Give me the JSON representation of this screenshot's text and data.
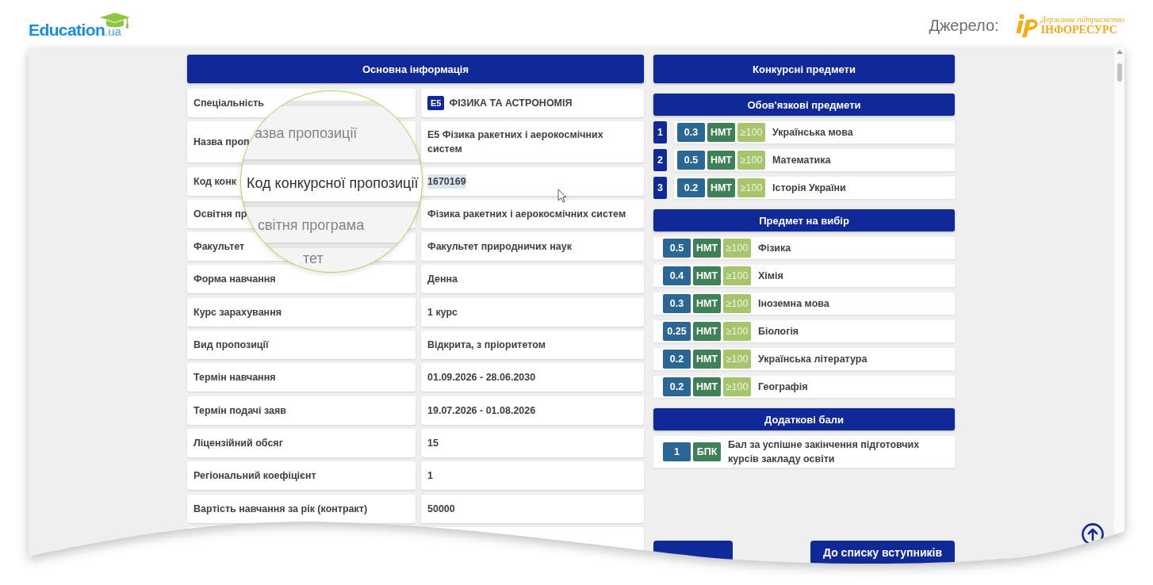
{
  "header": {
    "logo": {
      "name": "Education",
      "suffix": ".ua"
    },
    "source_label": "Джерело:",
    "source_logo": {
      "subtitle": "Державне підприємство",
      "name": "ІНФОРЕСУРС"
    }
  },
  "main_info": {
    "title": "Основна інформація",
    "rows": [
      {
        "label": "Спеціальність",
        "code": "E5",
        "value": "ФІЗИКА ТА АСТРОНОМІЯ",
        "text_selected": false
      },
      {
        "label": "Назва проп",
        "value": "E5 Фізика ракетних і аерокосмічних систем",
        "text_selected": false
      },
      {
        "label": "Код конк",
        "value": "1670169",
        "text_selected": true
      },
      {
        "label": "Освітня пр",
        "value": "Фізика ракетних і аерокосмічних систем",
        "text_selected": false
      },
      {
        "label": "Факультет",
        "value": "Факультет природничих наук",
        "text_selected": false
      },
      {
        "label": "Форма навчання",
        "value": "Денна",
        "text_selected": false
      },
      {
        "label": "Курс зарахування",
        "value": "1 курс",
        "text_selected": false
      },
      {
        "label": "Вид пропозиції",
        "value": "Відкрита, з пріоритетом",
        "text_selected": false
      },
      {
        "label": "Термін навчання",
        "value": "01.09.2026 - 28.06.2030",
        "text_selected": false
      },
      {
        "label": "Термін подачі заяв",
        "value": "19.07.2026 - 01.08.2026",
        "text_selected": false
      },
      {
        "label": "Ліцензійний обсяг",
        "value": "15",
        "text_selected": false
      },
      {
        "label": "Регіональний коефіцієнт",
        "value": "1",
        "text_selected": false
      },
      {
        "label": "Вартість навчання за рік (контракт)",
        "value": "50000",
        "text_selected": false
      }
    ],
    "trailing_empty_row": true
  },
  "magnifier": {
    "lines": [
      {
        "text": "азва пропозиції",
        "focused": false
      },
      {
        "text": "Код конкурсної пропозиції",
        "focused": true
      },
      {
        "text": "світня програма",
        "focused": false
      },
      {
        "text": "тет",
        "focused": false
      }
    ]
  },
  "competitive_subjects": {
    "title": "Конкурсні предмети",
    "groups": [
      {
        "title": "Обов'язкові предмети",
        "kind": "numbered",
        "subjects": [
          {
            "number": "1",
            "coefficient": "0.3",
            "test": "НМТ",
            "min_score": "≥100",
            "name": "Українська мова"
          },
          {
            "number": "2",
            "coefficient": "0.5",
            "test": "НМТ",
            "min_score": "≥100",
            "name": "Математика"
          },
          {
            "number": "3",
            "coefficient": "0.2",
            "test": "НМТ",
            "min_score": "≥100",
            "name": "Історія України"
          }
        ]
      },
      {
        "title": "Предмет на вибір",
        "kind": "plain",
        "subjects": [
          {
            "coefficient": "0.5",
            "test": "НМТ",
            "min_score": "≥100",
            "name": "Фізика"
          },
          {
            "coefficient": "0.4",
            "test": "НМТ",
            "min_score": "≥100",
            "name": "Хімія"
          },
          {
            "coefficient": "0.3",
            "test": "НМТ",
            "min_score": "≥100",
            "name": "Іноземна мова"
          },
          {
            "coefficient": "0.25",
            "test": "НМТ",
            "min_score": "≥100",
            "name": "Біологія"
          },
          {
            "coefficient": "0.2",
            "test": "НМТ",
            "min_score": "≥100",
            "name": "Українська література"
          },
          {
            "coefficient": "0.2",
            "test": "НМТ",
            "min_score": "≥100",
            "name": "Географія"
          }
        ]
      },
      {
        "title": "Додаткові бали",
        "kind": "plain",
        "subjects": [
          {
            "coefficient": "1",
            "test": "БПК",
            "name": "Бал за успішне закінчення підготовчих курсів закладу освіти"
          }
        ]
      }
    ]
  },
  "buttons": [
    {
      "kind": "covered"
    },
    {
      "kind": "labeled",
      "label": "До списку вступників"
    }
  ]
}
